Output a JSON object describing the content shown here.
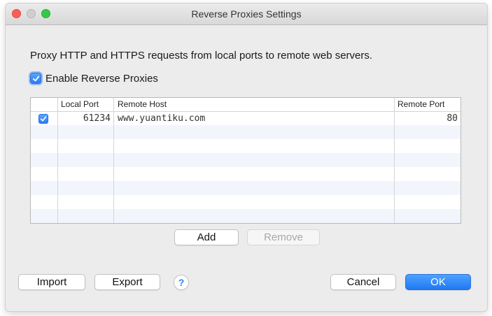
{
  "window": {
    "title": "Reverse Proxies Settings"
  },
  "description": "Proxy HTTP and HTTPS requests from local ports to remote web servers.",
  "enable": {
    "label": "Enable Reverse Proxies",
    "checked": true
  },
  "table": {
    "columns": [
      "Local Port",
      "Remote Host",
      "Remote Port"
    ],
    "rows": [
      {
        "enabled": true,
        "local_port": "61234",
        "remote_host": "www.yuantiku.com",
        "remote_port": "80"
      }
    ]
  },
  "buttons": {
    "add": "Add",
    "remove": "Remove",
    "import": "Import",
    "export": "Export",
    "help": "?",
    "cancel": "Cancel",
    "ok": "OK"
  },
  "colors": {
    "accent": "#2a7cf4"
  },
  "icons": {
    "checkbox": "checkmark-icon",
    "help": "question-mark-icon"
  }
}
